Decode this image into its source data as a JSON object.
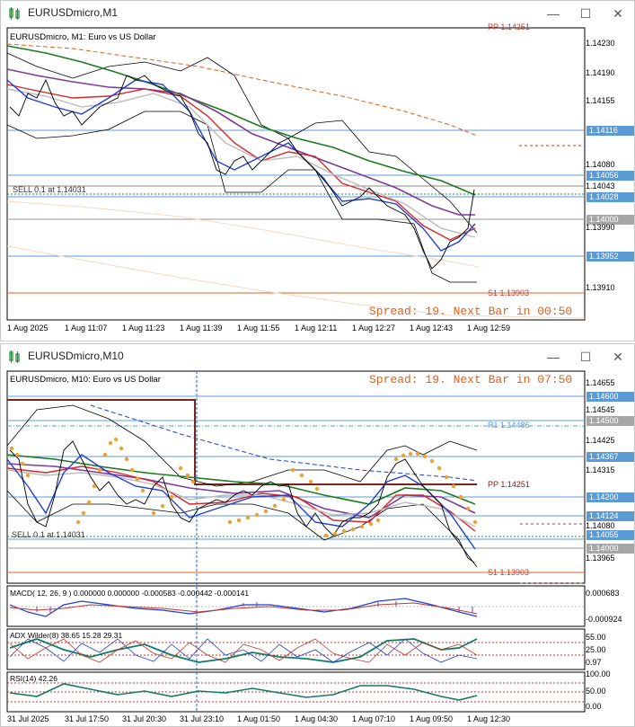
{
  "window1": {
    "title": "EURUSDmicro,M1",
    "header": "EURUSDmicro, M1:  Euro vs US Dollar",
    "top_level_label": "PP 1.14251",
    "sell_label": "SELL 0.1 at 1.14031",
    "s1_label": "S1 1.13903",
    "spread_text": "Spread: 19. Next Bar in 00:50",
    "prices": [
      "1.14230",
      "1.14190",
      "1.14155",
      "1.14080",
      "1.14040",
      "1.13990",
      "1.13910"
    ],
    "tags": {
      "p1": "1.14116",
      "p2": "1.14056",
      "p3": "1.14043",
      "p4": "1.14028",
      "p5": "1.14000",
      "p6": "1.13952"
    },
    "times": [
      "1 Aug 2025",
      "1 Aug 11:07",
      "1 Aug 11:23",
      "1 Aug 11:39",
      "1 Aug 11:55",
      "1 Aug 12:11",
      "1 Aug 12:27",
      "1 Aug 12:43",
      "1 Aug 12:59"
    ]
  },
  "window2": {
    "title": "EURUSDmicro,M10",
    "header": "EURUSDmicro, M10:  Euro vs US Dollar",
    "spread_text": "Spread: 19. Next Bar in 07:50",
    "r1_label": "R1 1.14486",
    "pp_label": "PP 1.14251",
    "s1_label": "S1 1.13903",
    "sell_label": "SELL 0.1 at 1.14031",
    "prices": [
      "1.14655",
      "1.14545",
      "1.14425",
      "1.14315",
      "1.14195",
      "1.14080",
      "1.13965"
    ],
    "tags": {
      "p1": "1.14600",
      "p2": "1.14500",
      "p3": "1.14367",
      "p4": "1.14200",
      "p5": "1.14124",
      "p6": "1.14055",
      "p7": "1.14000"
    },
    "macd_label": "MACD( 12, 26, 9 ) 0.000000  0.000000  -0.000583  -0.000442  -0.000141",
    "macd_levels": [
      "0.000683",
      "-0.000924"
    ],
    "adx_label": "ADX Wilder(8) 38.65 15.28 29.31",
    "adx_levels": [
      "55.00",
      "25.00",
      "0.97"
    ],
    "rsi_label": "RSI(14) 42.26",
    "rsi_levels": [
      "100.00",
      "50.00",
      "0.00"
    ],
    "times": [
      "31 Jul 2025",
      "31 Jul 17:50",
      "31 Jul 20:30",
      "31 Jul 23:10",
      "1 Aug 01:50",
      "1 Aug 04:30",
      "1 Aug 07:10",
      "1 Aug 09:50",
      "1 Aug 12:30"
    ]
  },
  "colors": {
    "tag_blue": "#5b9bd5",
    "tag_grey": "#a6a6a6",
    "level_red": "#c0392b",
    "pp_brown": "#7b241c",
    "spread_orange": "#e06020"
  }
}
